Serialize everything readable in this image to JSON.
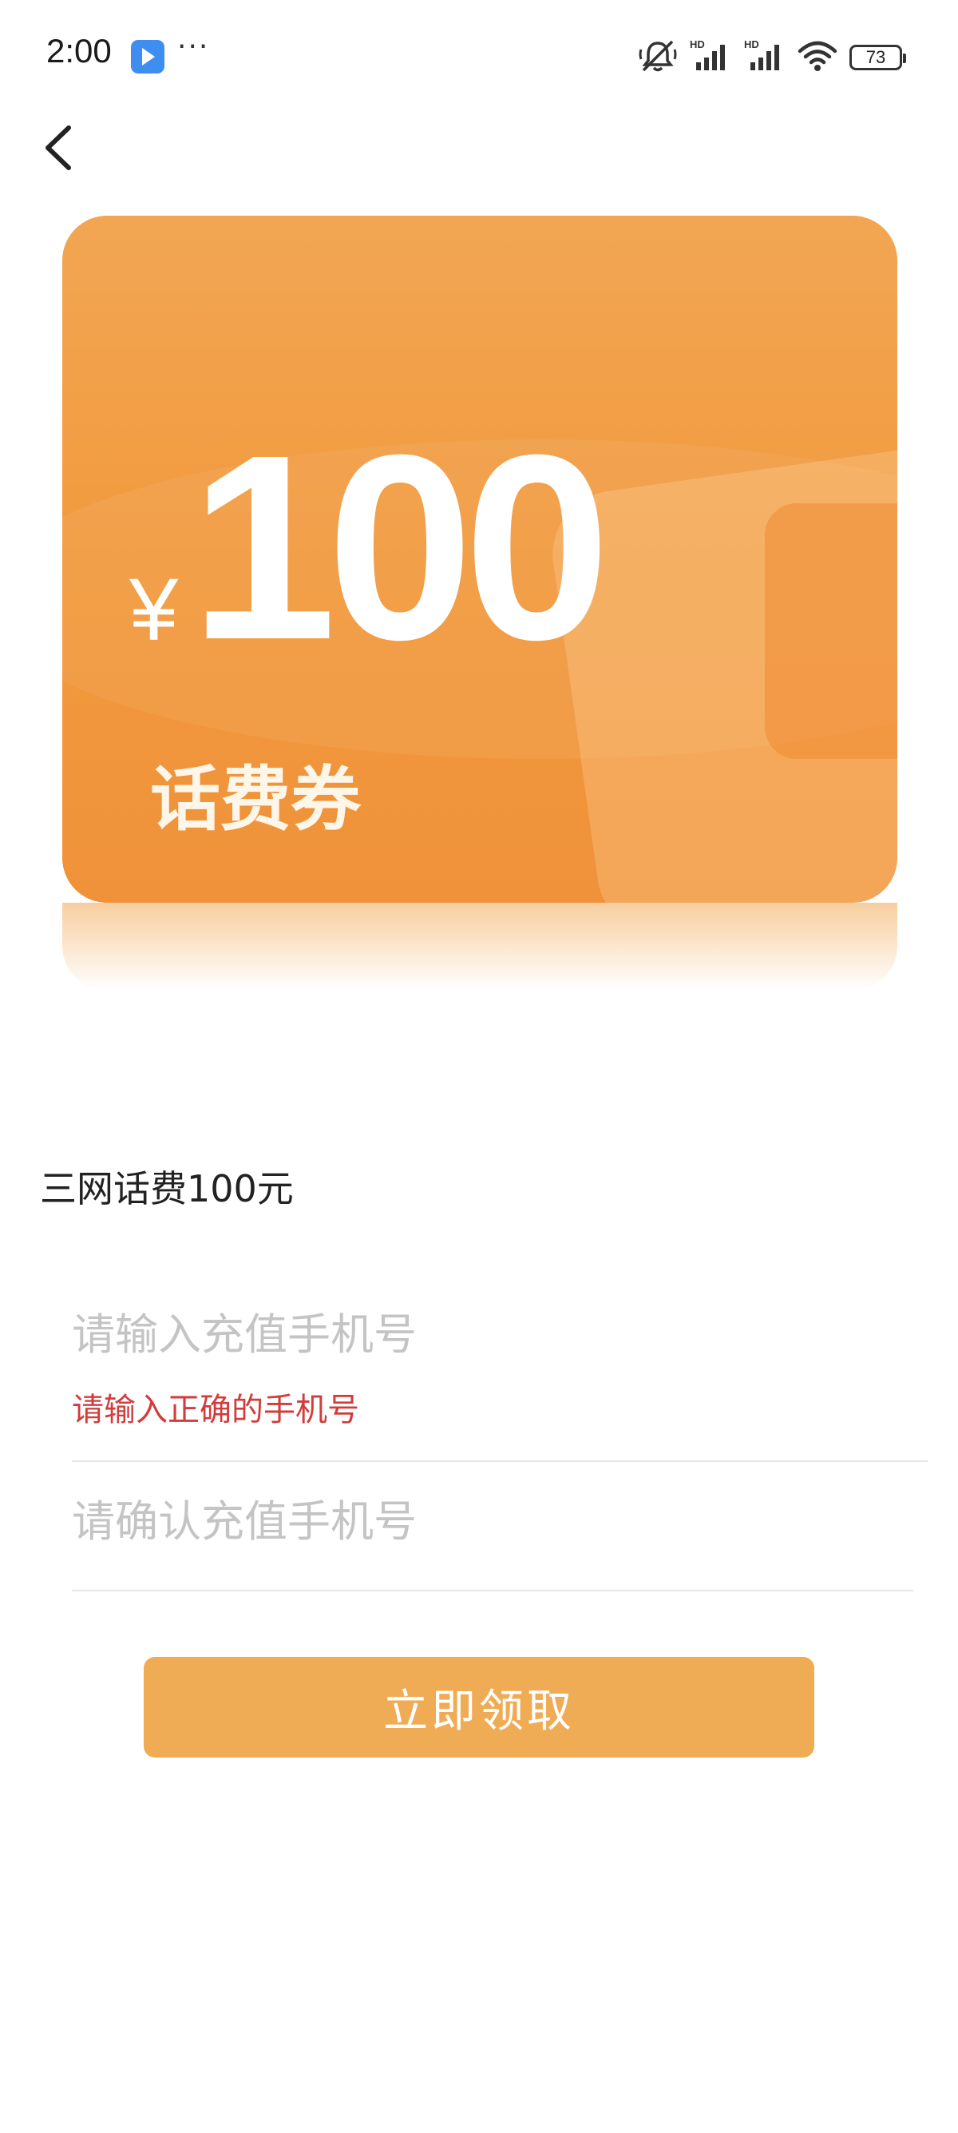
{
  "status_bar": {
    "time": "2:00",
    "more": "···",
    "battery": "73",
    "icons": [
      "app-notification-icon",
      "mute-icon",
      "signal-hd-icon",
      "signal-hd-icon",
      "wifi-icon",
      "battery-icon"
    ]
  },
  "nav": {
    "back_icon": "chevron-left-icon"
  },
  "coupon": {
    "currency": "¥",
    "amount": "100",
    "label": "话费券",
    "colors": {
      "card": "#f29a3e",
      "text": "#ffffff"
    }
  },
  "product": {
    "name": "三网话费100元"
  },
  "form": {
    "phone_placeholder": "请输入充值手机号",
    "phone_value": "",
    "phone_error": "请输入正确的手机号",
    "confirm_placeholder": "请确认充值手机号",
    "confirm_value": "",
    "submit_label": "立即领取",
    "colors": {
      "submit": "#f0ab55",
      "error": "#d23c3c",
      "placeholder": "#c4c4c4"
    }
  }
}
